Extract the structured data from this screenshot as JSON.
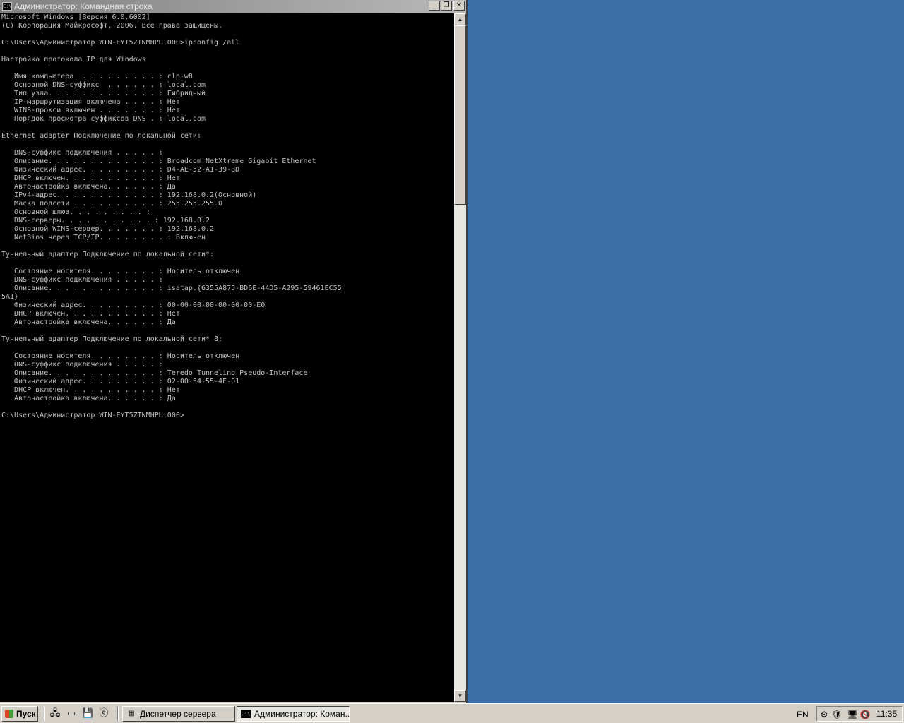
{
  "window": {
    "title": "Администратор: Командная строка",
    "icon_text": "C:\\",
    "btn_minimize": "_",
    "btn_restore": "❐",
    "btn_close": "✕"
  },
  "console": {
    "lines": [
      "Microsoft Windows [Версия 6.0.6002]",
      "(C) Корпорация Майкрософт, 2006. Все права защищены.",
      "",
      "C:\\Users\\Администратор.WIN-EYT5ZTNMHPU.000>ipconfig /all",
      "",
      "Настройка протокола IP для Windows",
      "",
      "   Имя компьютера  . . . . . . . . . : clp-w8",
      "   Основной DNS-суффикс  . . . . . . : local.com",
      "   Тип узла. . . . . . . . . . . . . : Гибридный",
      "   IP-маршрутизация включена . . . . : Нет",
      "   WINS-прокси включен . . . . . . . : Нет",
      "   Порядок просмотра суффиксов DNS . : local.com",
      "",
      "Ethernet adapter Подключение по локальной сети:",
      "",
      "   DNS-суффикс подключения . . . . . :",
      "   Описание. . . . . . . . . . . . . : Broadcom NetXtreme Gigabit Ethernet",
      "   Физический адрес. . . . . . . . . : D4-AE-52-A1-39-8D",
      "   DHCP включен. . . . . . . . . . . : Нет",
      "   Автонастройка включена. . . . . . : Да",
      "   IPv4-адрес. . . . . . . . . . . . : 192.168.0.2(Основной)",
      "   Маска подсети . . . . . . . . . . : 255.255.255.0",
      "   Основной шлюз. . . . . . . . . :",
      "   DNS-серверы. . . . . . . . . . . : 192.168.0.2",
      "   Основной WINS-сервер. . . . . . . : 192.168.0.2",
      "   NetBios через TCP/IP. . . . . . . . : Включен",
      "",
      "Туннельный адаптер Подключение по локальной сети*:",
      "",
      "   Состояние носителя. . . . . . . . : Носитель отключен",
      "   DNS-суффикс подключения . . . . . :",
      "   Описание. . . . . . . . . . . . . : isatap.{6355A875-BD6E-44D5-A295-59461EC55",
      "5A1}",
      "   Физический адрес. . . . . . . . . : 00-00-00-00-00-00-00-E0",
      "   DHCP включен. . . . . . . . . . . : Нет",
      "   Автонастройка включена. . . . . . : Да",
      "",
      "Туннельный адаптер Подключение по локальной сети* 8:",
      "",
      "   Состояние носителя. . . . . . . . : Носитель отключен",
      "   DNS-суффикс подключения . . . . . :",
      "   Описание. . . . . . . . . . . . . : Teredo Tunneling Pseudo-Interface",
      "   Физический адрес. . . . . . . . . : 02-00-54-55-4E-01",
      "   DHCP включен. . . . . . . . . . . : Нет",
      "   Автонастройка включена. . . . . . : Да",
      "",
      "C:\\Users\\Администратор.WIN-EYT5ZTNMHPU.000>"
    ]
  },
  "scrollbar": {
    "up": "▲",
    "down": "▼"
  },
  "taskbar": {
    "start_label": "Пуск",
    "quicklaunch": [
      {
        "name": "server-manager-quicklaunch-icon",
        "glyph": "🖧"
      },
      {
        "name": "show-desktop-icon",
        "glyph": "▭"
      },
      {
        "name": "save-icon",
        "glyph": "💾"
      },
      {
        "name": "internet-explorer-icon",
        "glyph": "ⓔ"
      }
    ],
    "tasks": [
      {
        "label": "Диспетчер сервера",
        "icon": "▦",
        "active": false
      },
      {
        "label": "Администратор: Коман...",
        "icon": "C:\\",
        "active": true
      }
    ],
    "language": "EN",
    "tray_icons": [
      "⚙",
      "🛡",
      "🖥",
      "🔇"
    ],
    "clock": "11:35"
  }
}
